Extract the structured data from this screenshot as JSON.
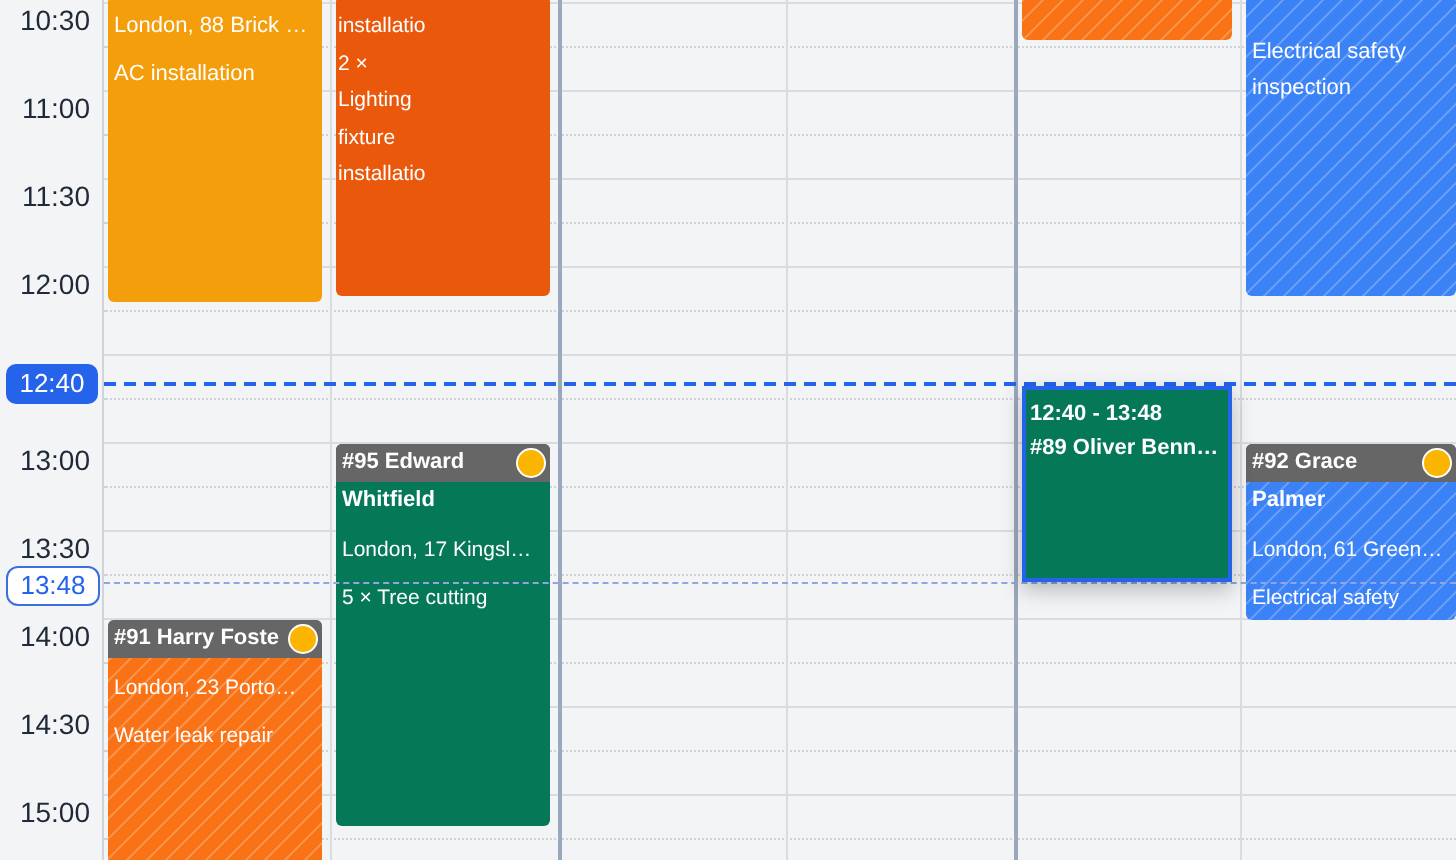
{
  "time_labels": [
    "10:30",
    "11:00",
    "11:30",
    "12:00",
    "13:00",
    "13:30",
    "14:00",
    "14:30",
    "15:00"
  ],
  "now_marker": {
    "label": "12:40"
  },
  "cursor_marker": {
    "label": "13:48"
  },
  "columns": [
    {
      "events": [
        {
          "kind": "plain",
          "color": "#f59e0b",
          "hatched": false,
          "selected": false,
          "lines": [
            "London, 88 Brick …",
            "AC installation"
          ]
        },
        {
          "kind": "header",
          "color": "#f97316",
          "hatched": true,
          "selected": false,
          "title": "#91 Harry Foste",
          "dot": {
            "color": "#fbb500"
          },
          "lines": [
            "London, 23 Porto…",
            "Water leak repair"
          ]
        }
      ]
    },
    {
      "events": [
        {
          "kind": "narrow",
          "color": "#ea580c",
          "hatched": false,
          "selected": false,
          "lines": [
            "installatio",
            "2 × Lighting fixture installatio"
          ]
        },
        {
          "kind": "header",
          "color": "#047857",
          "hatched": false,
          "selected": false,
          "title": "#95 Edward Whitfield",
          "dot": {
            "color": "#fbb500"
          },
          "lines": [
            "London, 17 Kingsl…",
            "5 × Tree cutting"
          ]
        }
      ]
    },
    {
      "events": [
        {
          "kind": "plain",
          "color": "#f97316",
          "hatched": true,
          "selected": false
        },
        {
          "kind": "preview",
          "color": "#047857",
          "hatched": false,
          "selected": true,
          "time": "12:40 - 13:48",
          "title": "#89 Oliver Benn…"
        }
      ]
    },
    {
      "events": [
        {
          "kind": "plain",
          "color": "#3b82f6",
          "hatched": true,
          "selected": false,
          "lines": [
            "Electrical safety inspection"
          ]
        },
        {
          "kind": "header",
          "color": "#3b82f6",
          "hatched": true,
          "selected": false,
          "title": "#92 Grace Palmer",
          "dot": {
            "color": "#fbb500"
          },
          "lines": [
            "London, 61 Green…",
            "Electrical safety"
          ]
        }
      ]
    }
  ]
}
